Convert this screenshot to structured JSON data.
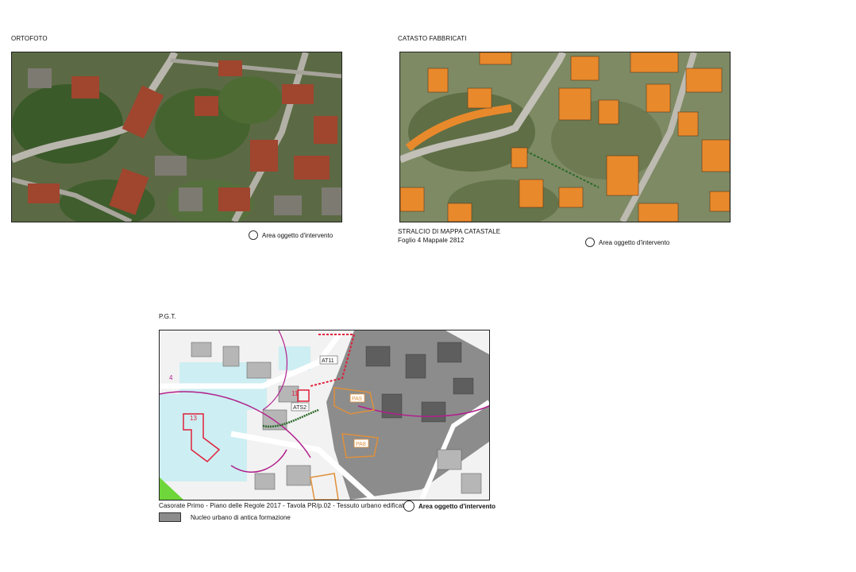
{
  "ortofoto": {
    "title": "ORTOFOTO",
    "legend": "Area oggetto d'intervento"
  },
  "catasto": {
    "title": "CATASTO FABBRICATI",
    "caption_line1": "STRALCIO DI MAPPA CATASTALE",
    "caption_line2": "Foglio 4 Mappale 2812",
    "legend": "Area oggetto d'intervento"
  },
  "pgt": {
    "title": "P.G.T.",
    "caption": "Casorate Primo - Piano delle Regole 2017 - Tavola PR/p.02 - Tessuto urbano edificato",
    "legend": "Area oggetto d'intervento",
    "swatch_label": "Nucleo urbano di antica formazione",
    "map_labels": {
      "at11": "AT11",
      "ats2": "ATS2",
      "pa9": "PA9",
      "pa8": "PA8",
      "n4": "4",
      "n11": "11",
      "n13": "13"
    }
  },
  "colors": {
    "buildings_orange": "#e8892c",
    "nucleo_gray": "#8c8c8c",
    "water_cyan": "#cdeef2",
    "pgt_magenta": "#b0208c",
    "pgt_red": "#e0203a",
    "pgt_orange": "#e0902a",
    "green_area": "#6ed63a"
  }
}
